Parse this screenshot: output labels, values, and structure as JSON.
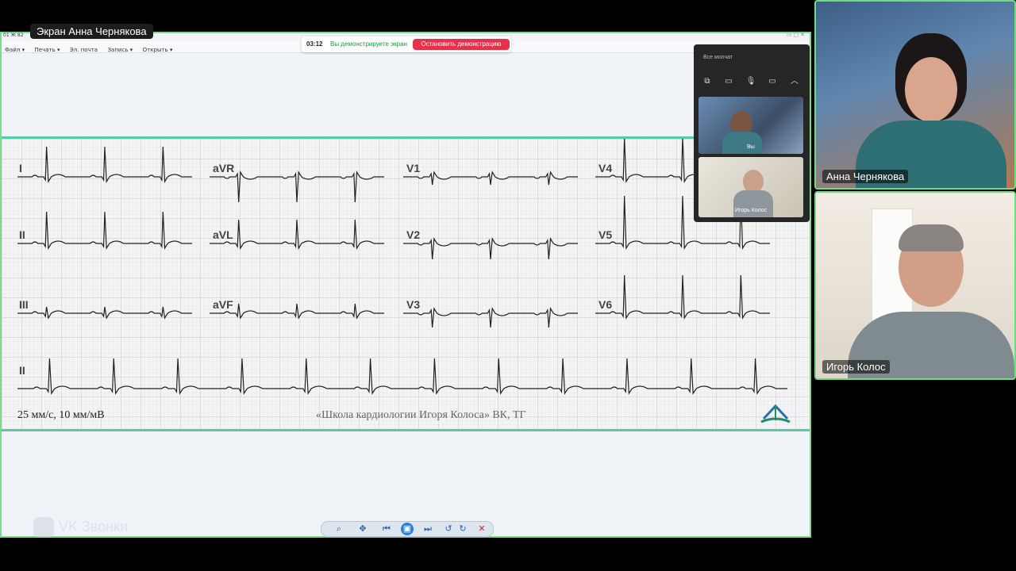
{
  "screen_share": {
    "label": "Экран Анна Чернякова",
    "window_title": "01 Ж 82",
    "menu": [
      "Файл ▾",
      "Печать ▾",
      "Эл. почта",
      "Запись ▾",
      "Открыть ▾"
    ]
  },
  "demo_bar": {
    "time": "03:12",
    "message": "Вы демонстрируете экран",
    "stop_label": "Остановить демонстрацию"
  },
  "ecg": {
    "leads": [
      "I",
      "aVR",
      "V1",
      "V4",
      "II",
      "aVL",
      "V2",
      "V5",
      "III",
      "aVF",
      "V3",
      "V6",
      "II"
    ],
    "speed_label": "25 мм/с, 10 мм/мВ",
    "watermark": "«Школа кардиологии Игоря Колоса» ВК, ТГ"
  },
  "call_panel": {
    "status": "Все молчат",
    "self_label": "Вы",
    "participant_label": "Игорь Колос"
  },
  "participants": [
    {
      "name": "Анна Чернякова"
    },
    {
      "name": "Игорь Колос"
    }
  ],
  "brand": "VK Звонки",
  "colors": {
    "accent_green": "#6fdc7f",
    "stop_red": "#e8304a",
    "ecg_border": "#57c9a8"
  }
}
